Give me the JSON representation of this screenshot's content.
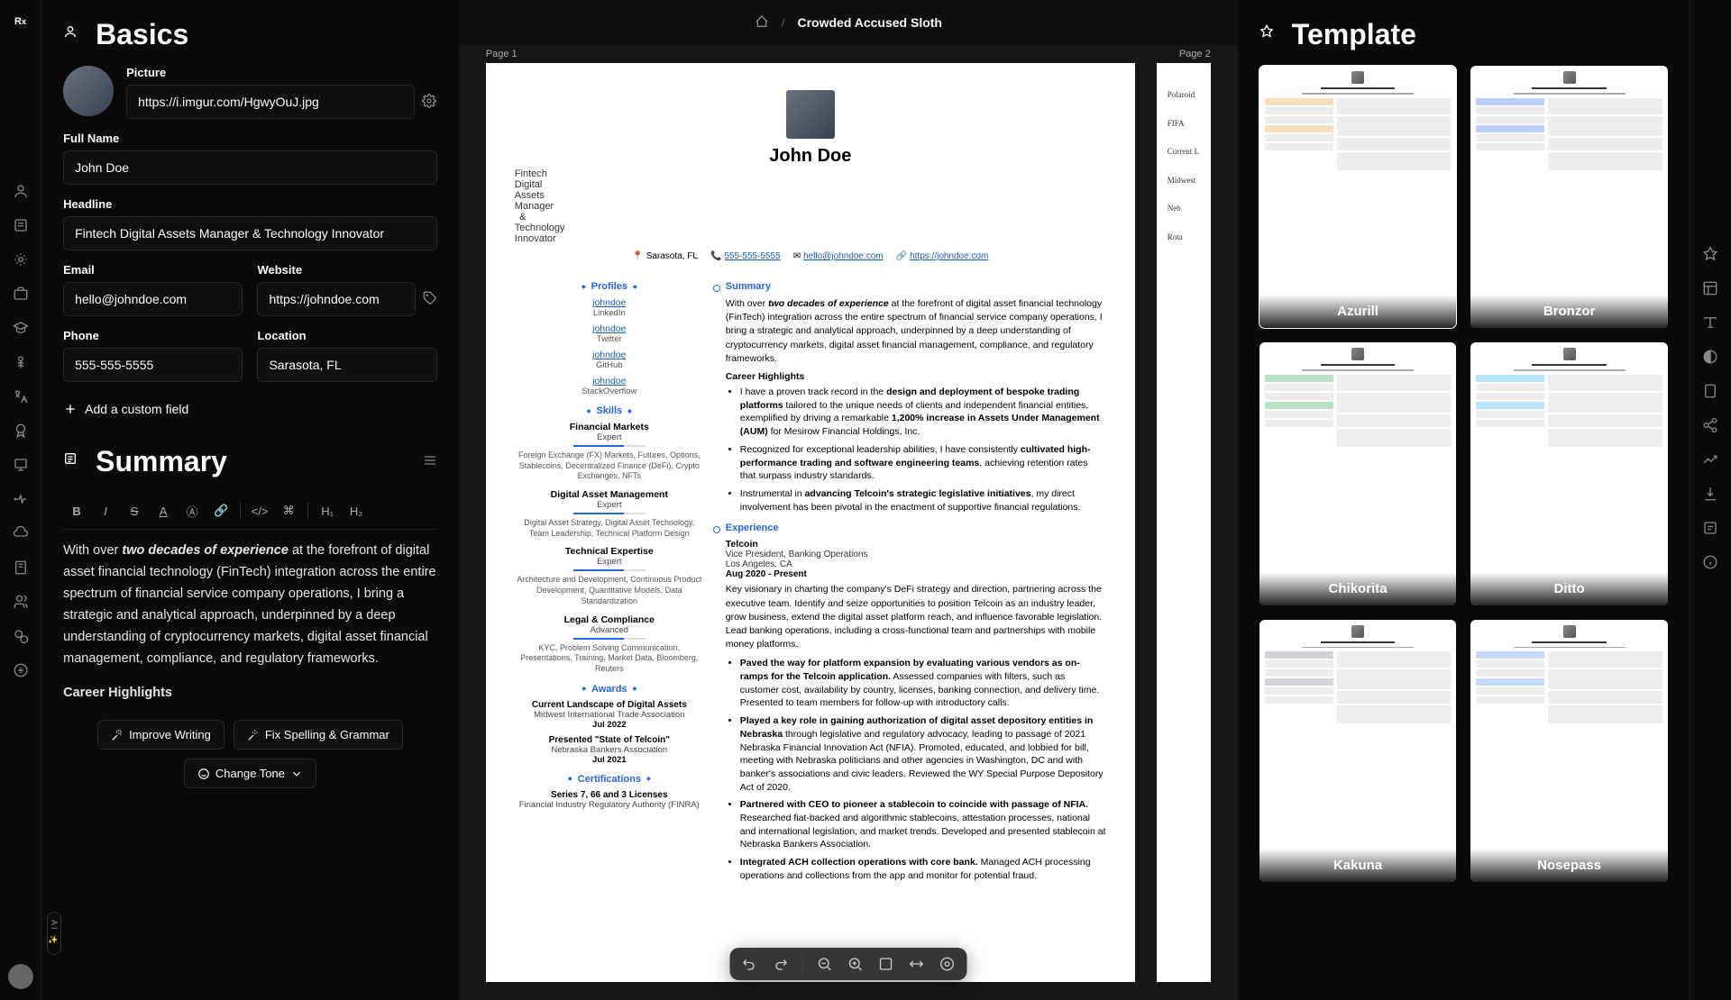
{
  "breadcrumb": {
    "title": "Crowded Accused Sloth"
  },
  "basics": {
    "heading": "Basics",
    "picture_label": "Picture",
    "picture_url": "https://i.imgur.com/HgwyOuJ.jpg",
    "fullname_label": "Full Name",
    "fullname": "John Doe",
    "headline_label": "Headline",
    "headline": "Fintech Digital Assets Manager & Technology Innovator",
    "email_label": "Email",
    "email": "hello@johndoe.com",
    "website_label": "Website",
    "website": "https://johndoe.com",
    "phone_label": "Phone",
    "phone": "555-555-5555",
    "location_label": "Location",
    "location": "Sarasota, FL",
    "add_custom": "Add a custom field"
  },
  "summary": {
    "heading": "Summary",
    "body_prefix": "With over ",
    "body_em": "two decades of experience",
    "body_rest": " at the forefront of digital asset financial technology (FinTech) integration across the entire spectrum of financial service company operations, I bring a strategic and analytical approach, underpinned by a deep understanding of cryptocurrency markets, digital asset financial management, compliance, and regulatory frameworks.",
    "highlights_title": "Career Highlights",
    "btn_improve": "Improve Writing",
    "btn_fix": "Fix Spelling & Grammar",
    "btn_tone": "Change Tone"
  },
  "resume": {
    "name": "John Doe",
    "headline": "Fintech Digital Assets Manager & Technology Innovator",
    "location": "Sarasota, FL",
    "phone": "555-555-5555",
    "email": "hello@johndoe.com",
    "site": "https://johndoe.com",
    "sections": {
      "profiles": "Profiles",
      "skills": "Skills",
      "awards": "Awards",
      "certs": "Certifications",
      "summary": "Summary",
      "experience": "Experience"
    },
    "profiles": [
      {
        "handle": "johndoe",
        "net": "LinkedIn"
      },
      {
        "handle": "johndoe",
        "net": "Twitter"
      },
      {
        "handle": "johndoe",
        "net": "GitHub"
      },
      {
        "handle": "johndoe",
        "net": "StackOverflow"
      }
    ],
    "skills": [
      {
        "name": "Financial Markets",
        "level": "Expert",
        "kw": "Foreign Exchange (FX) Markets, Futures, Options, Stablecoins, Decentralized Finance (DeFi), Crypto Exchanges, NFTs"
      },
      {
        "name": "Digital Asset Management",
        "level": "Expert",
        "kw": "Digital Asset Strategy, Digital Asset Technology, Team Leadership, Technical Platform Design"
      },
      {
        "name": "Technical Expertise",
        "level": "Expert",
        "kw": "Architecture and Development, Continuous Product Development, Quantitative Models, Data Standardization"
      },
      {
        "name": "Legal & Compliance",
        "level": "Advanced",
        "kw": "KYC, Problem Solving Communication, Presentations, Training, Market Data, Bloomberg, Reuters"
      }
    ],
    "awards": [
      {
        "name": "Current Landscape of Digital Assets",
        "org": "Midwest International Trade Association",
        "date": "Jul 2022"
      },
      {
        "name": "Presented \"State of Telcoin\"",
        "org": "Nebraska Bankers Association",
        "date": "Jul 2021"
      }
    ],
    "certs": [
      {
        "name": "Series 7, 66 and 3 Licenses",
        "org": "Financial Industry Regulatory Authority (FINRA)"
      }
    ],
    "summary_text_prefix": "With over ",
    "summary_text_em": "two decades of experience",
    "summary_text_rest": " at the forefront of digital asset financial technology (FinTech) integration across the entire spectrum of financial service company operations, I bring a strategic and analytical approach, underpinned by a deep understanding of cryptocurrency markets, digital asset financial management, compliance, and regulatory frameworks.",
    "highlights_title": "Career Highlights",
    "highlights": [
      {
        "pre": "I have a proven track record in the ",
        "b": "design and deployment of bespoke trading platforms",
        "mid": " tailored to the unique needs of clients and independent financial entities, exemplified by driving a remarkable ",
        "b2": "1,200% increase in Assets Under Management (AUM)",
        "post": " for Mesirow Financial Holdings, Inc."
      },
      {
        "pre": "Recognized for exceptional leadership abilities, I have consistently ",
        "b": "cultivated high-performance trading and software engineering teams",
        "post": ", achieving retention rates that surpass industry standards."
      },
      {
        "pre": "Instrumental in ",
        "b": "advancing Telcoin's strategic legislative initiatives",
        "post": ", my direct involvement has been pivotal in the enactment of supportive financial regulations."
      }
    ],
    "experience": [
      {
        "company": "Telcoin",
        "title": "Vice President, Banking Operations",
        "loc": "Los Angeles, CA",
        "date": "Aug 2020 - Present",
        "desc": "Key visionary in charting the company's DeFi strategy and direction, partnering across the executive team. Identify and seize opportunities to position Telcoin as an industry leader, grow business, extend the digital asset platform reach, and influence favorable legislation. Lead banking operations, including a cross-functional team and partnerships with mobile money platforms.",
        "bullets": [
          {
            "b": "Paved the way for platform expansion by evaluating various vendors as on-ramps for the Telcoin application.",
            "r": " Assessed companies with filters, such as customer cost, availability by country, licenses, banking connection, and delivery time. Presented to team members for follow-up with introductory calls."
          },
          {
            "b": "Played a key role in gaining authorization of digital asset depository entities in Nebraska",
            "r": " through legislative and regulatory advocacy, leading to passage of 2021 Nebraska Financial Innovation Act (NFIA). Promoted, educated, and lobbied for bill, meeting with Nebraska politicians and other agencies in Washington, DC and with banker's associations and civic leaders. Reviewed the WY Special Purpose Depository Act of 2020."
          },
          {
            "b": "Partnered with CEO to pioneer a stablecoin to coincide with passage of NFIA.",
            "r": " Researched fiat-backed and algorithmic stablecoins, attestation processes, national and international legislation, and market trends. Developed and presented stablecoin at Nebraska Bankers Association."
          },
          {
            "b": "Integrated ACH collection operations with core bank.",
            "r": " Managed ACH processing operations and collections from the app and monitor for potential fraud."
          }
        ]
      }
    ]
  },
  "page2_hints": [
    "Polaroid",
    "FIFA",
    "Current L",
    "Midwest",
    "Neb",
    "Rota"
  ],
  "pages": {
    "p1": "Page 1",
    "p2": "Page 2"
  },
  "template": {
    "heading": "Template",
    "items": [
      {
        "name": "Azurill",
        "accent": "#d4a017",
        "selected": true
      },
      {
        "name": "Bronzor",
        "accent": "#2563eb",
        "selected": false
      },
      {
        "name": "Chikorita",
        "accent": "#16a34a",
        "selected": false
      },
      {
        "name": "Ditto",
        "accent": "#0ea5e9",
        "selected": false
      },
      {
        "name": "Kakuna",
        "accent": "#6b7280",
        "selected": false
      },
      {
        "name": "Nosepass",
        "accent": "#3b82f6",
        "selected": false
      }
    ]
  }
}
